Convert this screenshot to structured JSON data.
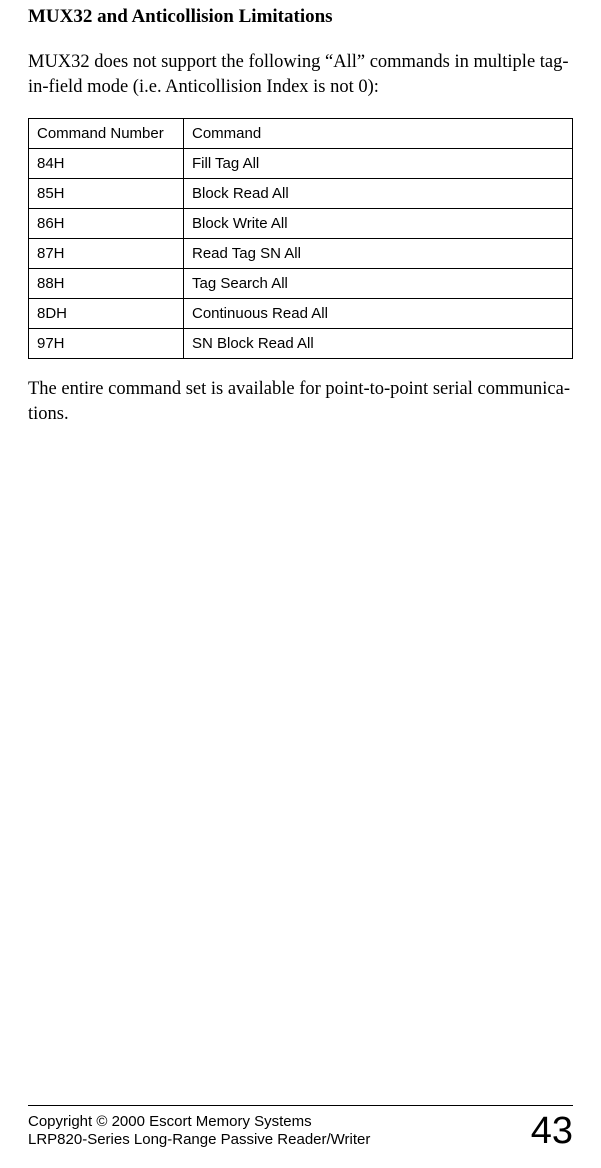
{
  "heading": "MUX32 and Anticollision Limitations",
  "intro": "MUX32 does not support the following “All” commands in multiple tag-in-field mode (i.e. Anticollision Index is not 0):",
  "table": {
    "headers": {
      "num": "Command Number",
      "cmd": "Command"
    },
    "rows": [
      {
        "num": "84H",
        "cmd": "Fill Tag All"
      },
      {
        "num": "85H",
        "cmd": "Block Read All"
      },
      {
        "num": "86H",
        "cmd": "Block Write All"
      },
      {
        "num": "87H",
        "cmd": "Read Tag SN All"
      },
      {
        "num": "88H",
        "cmd": "Tag Search All"
      },
      {
        "num": "8DH",
        "cmd": "Continuous Read All"
      },
      {
        "num": "97H",
        "cmd": "SN Block Read All"
      }
    ]
  },
  "outro": "The entire command set is available for point-to-point serial communica­tions.",
  "footer": {
    "line1": "Copyright © 2000 Escort Memory Systems",
    "line2": "LRP820-Series Long-Range Passive Reader/Writer",
    "page": "43"
  }
}
